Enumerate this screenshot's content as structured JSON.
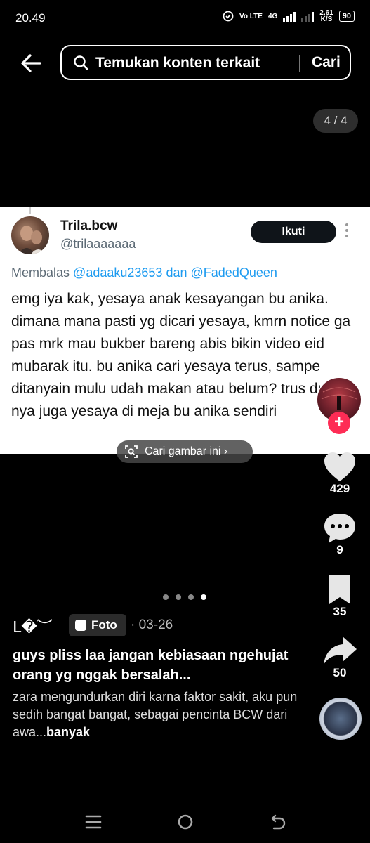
{
  "status_bar": {
    "time": "20.49",
    "network_label": "Vo LTE",
    "network_type": "4G",
    "speed_value": "2,61",
    "speed_unit": "K/S",
    "battery": "90"
  },
  "header": {
    "search_placeholder": "Temukan konten terkait",
    "search_button": "Cari"
  },
  "page_counter": "4 / 4",
  "tweet": {
    "display_name": "Trila.bcw",
    "handle": "@trilaaaaaaa",
    "follow_label": "Ikuti",
    "reply_prefix": "Membalas",
    "reply_mention_1": "@adaaku23653",
    "reply_conjunction": "dan",
    "reply_mention_2": "@FadedQueen",
    "text": "emg iya kak, yesaya anak kesayangan bu anika. dimana mana pasti yg dicari yesaya, kmrn notice ga pas mrk mau bukber bareng abis bikin video eid mubarak itu. bu anika cari yesaya terus, sampe ditanyain mulu udah makan atau belum? trus duduk nya juga yesaya di meja bu anika sendiri"
  },
  "search_image_label": "Cari gambar ini",
  "actions": {
    "likes": "429",
    "comments": "9",
    "saves": "35",
    "shares": "50"
  },
  "carousel": {
    "total": 4,
    "active": 4
  },
  "post": {
    "author": "ᒪ�ׁ︶",
    "type_badge": "Foto",
    "date": "· 03-26",
    "title": "guys pliss laa jangan kebiasaan ngehujat orang yg nggak bersalah...",
    "body": "zara mengundurkan diri karna faktor sakit, aku pun sedih bangat bangat, sebagai pencinta BCW dari awa...",
    "more_label": "banyak"
  },
  "colors": {
    "background": "#000000",
    "follow_plus": "#fe2c55",
    "mention": "#1d9bf0",
    "follow_button": "#0f1419"
  },
  "icons": [
    "arrow-left-icon",
    "search-icon",
    "heart-icon",
    "comment-icon",
    "bookmark-icon",
    "share-icon",
    "image-search-icon",
    "photo-icon",
    "menu-icon",
    "home-circle-icon",
    "back-nav-icon"
  ]
}
